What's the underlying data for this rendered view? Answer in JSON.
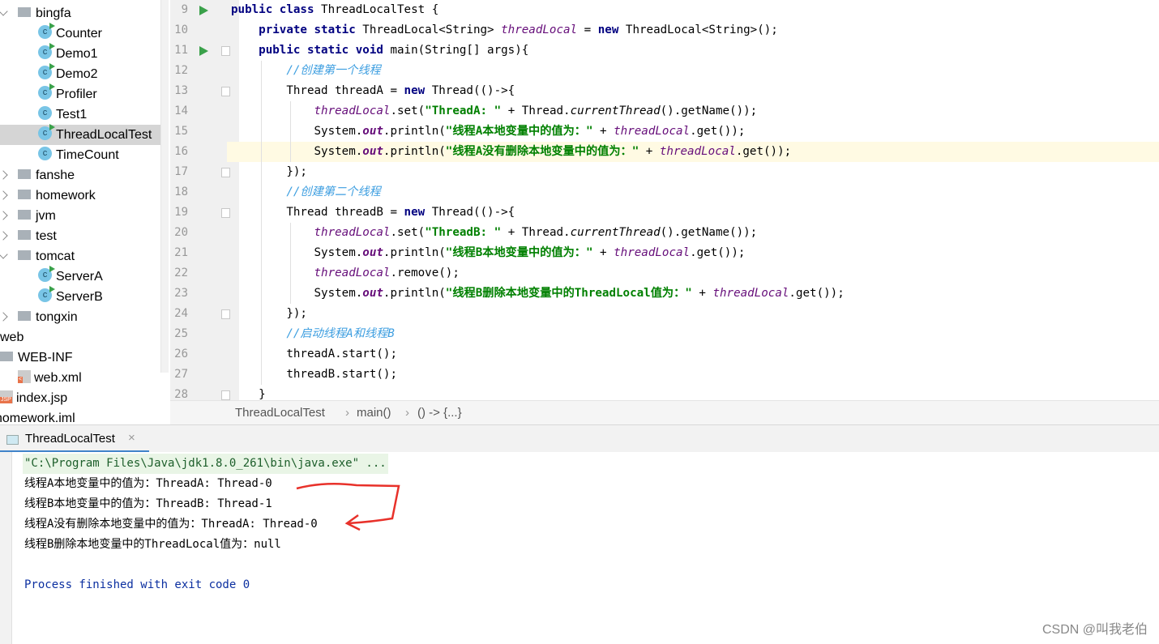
{
  "tree": [
    {
      "label": "bingfa",
      "type": "folder",
      "open": true,
      "depth": 1
    },
    {
      "label": "Counter",
      "type": "class-run",
      "depth": 2
    },
    {
      "label": "Demo1",
      "type": "class-run",
      "depth": 2
    },
    {
      "label": "Demo2",
      "type": "class-run",
      "depth": 2
    },
    {
      "label": "Profiler",
      "type": "class-run",
      "depth": 2
    },
    {
      "label": "Test1",
      "type": "class",
      "depth": 2
    },
    {
      "label": "ThreadLocalTest",
      "type": "class-run",
      "depth": 2,
      "selected": true
    },
    {
      "label": "TimeCount",
      "type": "class",
      "depth": 2
    },
    {
      "label": "fanshe",
      "type": "folder",
      "depth": 1
    },
    {
      "label": "homework",
      "type": "folder",
      "depth": 1
    },
    {
      "label": "jvm",
      "type": "folder",
      "depth": 1
    },
    {
      "label": "test",
      "type": "folder",
      "depth": 1
    },
    {
      "label": "tomcat",
      "type": "folder",
      "open": true,
      "depth": 1
    },
    {
      "label": "ServerA",
      "type": "class-run",
      "depth": 2
    },
    {
      "label": "ServerB",
      "type": "class-run",
      "depth": 2
    },
    {
      "label": "tongxin",
      "type": "folder",
      "depth": 1
    },
    {
      "label": "web",
      "type": "text",
      "depth": -1
    },
    {
      "label": "WEB-INF",
      "type": "folder",
      "depth": -2
    },
    {
      "label": "web.xml",
      "type": "xml",
      "depth": 0
    },
    {
      "label": "index.jsp",
      "type": "jsp",
      "depth": -2
    },
    {
      "label": "homework.iml",
      "type": "text",
      "depth": -3
    }
  ],
  "editor": {
    "highlighted_line": 16,
    "lines": [
      {
        "n": "9",
        "run": true,
        "t": [
          [
            "public class ",
            "kw"
          ],
          [
            "ThreadLocalTest {",
            ""
          ]
        ]
      },
      {
        "n": "10",
        "t": [
          [
            "    private static ",
            "kw"
          ],
          [
            "ThreadLocal<String> ",
            ""
          ],
          [
            "threadLocal",
            "fld"
          ],
          [
            " = ",
            ""
          ],
          [
            "new ",
            "kw"
          ],
          [
            "ThreadLocal<String>();",
            ""
          ]
        ]
      },
      {
        "n": "11",
        "run": true,
        "fold": true,
        "t": [
          [
            "    public static void ",
            "kw"
          ],
          [
            "main(String[] args){",
            ""
          ]
        ]
      },
      {
        "n": "12",
        "t": [
          [
            "        //创建第一个线程",
            "cmt"
          ]
        ]
      },
      {
        "n": "13",
        "fold": true,
        "t": [
          [
            "        Thread threadA = ",
            ""
          ],
          [
            "new ",
            "kw"
          ],
          [
            "Thread(()->{",
            ""
          ]
        ]
      },
      {
        "n": "14",
        "t": [
          [
            "            ",
            ""
          ],
          [
            "threadLocal",
            "fld"
          ],
          [
            ".set(",
            ""
          ],
          [
            "\"ThreadA: \"",
            "str"
          ],
          [
            " + Thread.",
            ""
          ],
          [
            "currentThread",
            "sti"
          ],
          [
            "().getName());",
            ""
          ]
        ]
      },
      {
        "n": "15",
        "t": [
          [
            "            System.",
            ""
          ],
          [
            "out",
            "out"
          ],
          [
            ".println(",
            ""
          ],
          [
            "\"线程A本地变量中的值为：\"",
            "str"
          ],
          [
            " + ",
            ""
          ],
          [
            "threadLocal",
            "fld"
          ],
          [
            ".get());",
            ""
          ]
        ]
      },
      {
        "n": "16",
        "t": [
          [
            "            System.",
            ""
          ],
          [
            "out",
            "out"
          ],
          [
            ".println(",
            ""
          ],
          [
            "\"线程A没有删除本地变量中的值为：\"",
            "str"
          ],
          [
            " + ",
            ""
          ],
          [
            "threadLocal",
            "fld"
          ],
          [
            ".get());",
            ""
          ]
        ]
      },
      {
        "n": "17",
        "fold": true,
        "t": [
          [
            "        });",
            ""
          ]
        ]
      },
      {
        "n": "18",
        "t": [
          [
            "        //创建第二个线程",
            "cmt"
          ]
        ]
      },
      {
        "n": "19",
        "fold": true,
        "t": [
          [
            "        Thread threadB = ",
            ""
          ],
          [
            "new ",
            "kw"
          ],
          [
            "Thread(()->{",
            ""
          ]
        ]
      },
      {
        "n": "20",
        "t": [
          [
            "            ",
            ""
          ],
          [
            "threadLocal",
            "fld"
          ],
          [
            ".set(",
            ""
          ],
          [
            "\"ThreadB: \"",
            "str"
          ],
          [
            " + Thread.",
            ""
          ],
          [
            "currentThread",
            "sti"
          ],
          [
            "().getName());",
            ""
          ]
        ]
      },
      {
        "n": "21",
        "t": [
          [
            "            System.",
            ""
          ],
          [
            "out",
            "out"
          ],
          [
            ".println(",
            ""
          ],
          [
            "\"线程B本地变量中的值为：\"",
            "str"
          ],
          [
            " + ",
            ""
          ],
          [
            "threadLocal",
            "fld"
          ],
          [
            ".get());",
            ""
          ]
        ]
      },
      {
        "n": "22",
        "t": [
          [
            "            ",
            ""
          ],
          [
            "threadLocal",
            "fld"
          ],
          [
            ".remove();",
            ""
          ]
        ]
      },
      {
        "n": "23",
        "t": [
          [
            "            System.",
            ""
          ],
          [
            "out",
            "out"
          ],
          [
            ".println(",
            ""
          ],
          [
            "\"线程B删除本地变量中的ThreadLocal值为：\"",
            "str"
          ],
          [
            " + ",
            ""
          ],
          [
            "threadLocal",
            "fld"
          ],
          [
            ".get());",
            ""
          ]
        ]
      },
      {
        "n": "24",
        "fold": true,
        "t": [
          [
            "        });",
            ""
          ]
        ]
      },
      {
        "n": "25",
        "t": [
          [
            "        //启动线程A和线程B",
            "cmt"
          ]
        ]
      },
      {
        "n": "26",
        "t": [
          [
            "        threadA.start();",
            ""
          ]
        ]
      },
      {
        "n": "27",
        "t": [
          [
            "        threadB.start();",
            ""
          ]
        ]
      },
      {
        "n": "28",
        "fold": true,
        "t": [
          [
            "    }",
            ""
          ]
        ]
      }
    ]
  },
  "breadcrumb": [
    "ThreadLocalTest",
    "main()",
    "() -> {...}"
  ],
  "run_tab": {
    "label": "ThreadLocalTest",
    "close": "×"
  },
  "console": {
    "command": "\"C:\\Program Files\\Java\\jdk1.8.0_261\\bin\\java.exe\" ...",
    "output": [
      "线程A本地变量中的值为：ThreadA: Thread-0",
      "线程B本地变量中的值为：ThreadB: Thread-1",
      "线程A没有删除本地变量中的值为：ThreadA: Thread-0",
      "线程B删除本地变量中的ThreadLocal值为：null"
    ],
    "exit": "Process finished with exit code 0"
  },
  "watermark": "CSDN @叫我老伯",
  "colors": {
    "annotation": "#e8312a",
    "accent": "#4083c9"
  }
}
